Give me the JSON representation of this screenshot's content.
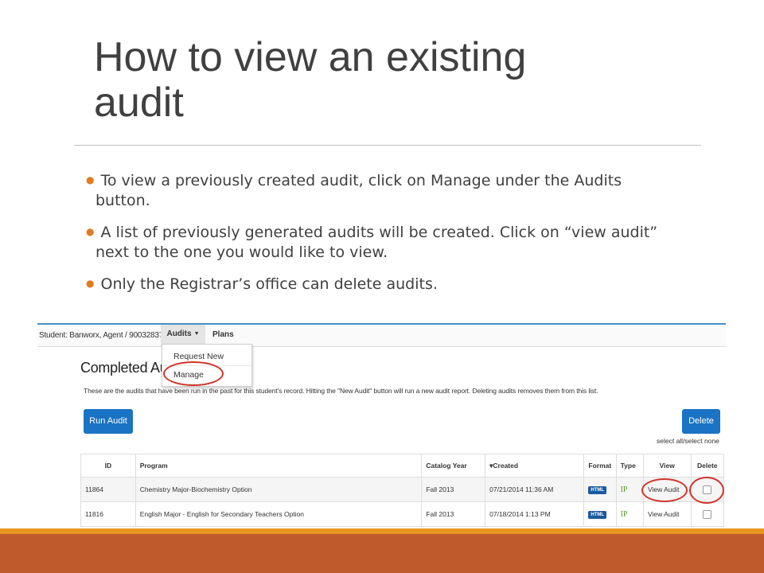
{
  "slide": {
    "title_line1": "How to view an existing",
    "title_line2": "audit",
    "bullets": [
      "To view a previously created audit, click on Manage under the Audits button.",
      "A list of previously generated audits will be created. Click on “view audit” next to the one you would like to view.",
      "Only the Registrar’s office can delete audits."
    ],
    "accent_color": "#e07b22",
    "footer_color": "#bf5a2b"
  },
  "app": {
    "student_info": "Student: Banworx, Agent / 900328372",
    "nav": {
      "audits_label": "Audits",
      "plans_label": "Plans"
    },
    "audits_menu": {
      "request_new": "Request New",
      "manage": "Manage"
    },
    "heading": "Completed Aud",
    "description": "These are the audits that have been run in the past for this student's record. Hitting the \"New Audit\" button will run a new audit report. Deleting audits removes them from this list.",
    "run_audit_label": "Run Audit",
    "delete_label": "Delete",
    "select_all_label": "select all/select none",
    "table": {
      "headers": [
        "ID",
        "Program",
        "Catalog Year",
        "Created",
        "Format",
        "Type",
        "View",
        "Delete"
      ],
      "sort_indicator": "▾",
      "rows": [
        {
          "id": "11864",
          "program": "Chemistry Major-Biochemistry Option",
          "catalog_year": "Fall 2013",
          "created": "07/21/2014 11:36 AM",
          "format": "HTML",
          "type": "IP",
          "view": "View Audit"
        },
        {
          "id": "11816",
          "program": "English Major - English for Secondary Teachers Option",
          "catalog_year": "Fall 2013",
          "created": "07/18/2014 1:13 PM",
          "format": "HTML",
          "type": "IP",
          "view": "View Audit"
        }
      ]
    },
    "button_color": "#1a73c4",
    "highlight_color": "#d0352a"
  }
}
